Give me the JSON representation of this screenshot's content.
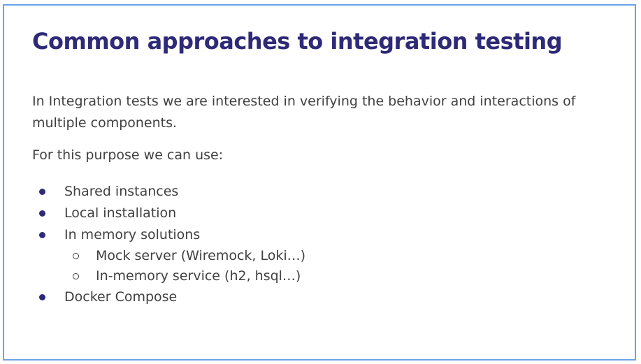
{
  "slide": {
    "title": "Common approaches to integration testing",
    "intro": "In Integration tests we are interested in verifying the behavior and interactions of multiple components.",
    "lead": "For this purpose we can use:",
    "items": [
      {
        "label": "Shared instances"
      },
      {
        "label": "Local installation"
      },
      {
        "label": "In memory solutions"
      },
      {
        "label": "Mock server (Wiremock, Loki…)"
      },
      {
        "label": "In-memory service (h2, hsql…)"
      },
      {
        "label": "Docker Compose"
      }
    ]
  },
  "colors": {
    "title": "#2e2a78",
    "text": "#404040",
    "bullet": "#2e2a78",
    "border": "#6aa3e6"
  }
}
